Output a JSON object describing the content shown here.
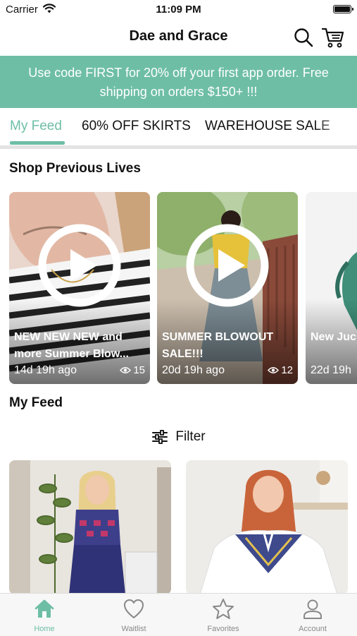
{
  "status_bar": {
    "carrier": "Carrier",
    "time": "11:09 PM"
  },
  "nav": {
    "title": "Dae and Grace",
    "search_icon": "search-icon",
    "cart_icon": "cart-icon"
  },
  "promo": {
    "text": "Use code FIRST for 20% off your first app order. Free shipping on orders $150+ !!!"
  },
  "tabs": [
    {
      "label": "My Feed",
      "active": true
    },
    {
      "label": "60% OFF SKIRTS",
      "active": false
    },
    {
      "label": "WAREHOUSE SALE",
      "active": false
    }
  ],
  "previous_lives": {
    "title": "Shop Previous Lives",
    "items": [
      {
        "title": "NEW NEW NEW and more Summer Blow...",
        "ago": "14d 19h ago",
        "views": "15"
      },
      {
        "title": "SUMMER BLOWOUT SALE!!!",
        "ago": "20d 19h ago",
        "views": "12"
      },
      {
        "title": "New Juc dresses,",
        "ago": "22d 19h",
        "views": ""
      }
    ]
  },
  "feed": {
    "title": "My Feed",
    "filter_label": "Filter"
  },
  "tab_bar": [
    {
      "label": "Home",
      "icon": "home-icon",
      "active": true
    },
    {
      "label": "Waitlist",
      "icon": "heart-icon",
      "active": false
    },
    {
      "label": "Favorites",
      "icon": "star-icon",
      "active": false
    },
    {
      "label": "Account",
      "icon": "person-icon",
      "active": false
    }
  ],
  "colors": {
    "accent": "#6ebea6",
    "tab_inactive": "#888888",
    "divider": "#e3e3e3"
  }
}
